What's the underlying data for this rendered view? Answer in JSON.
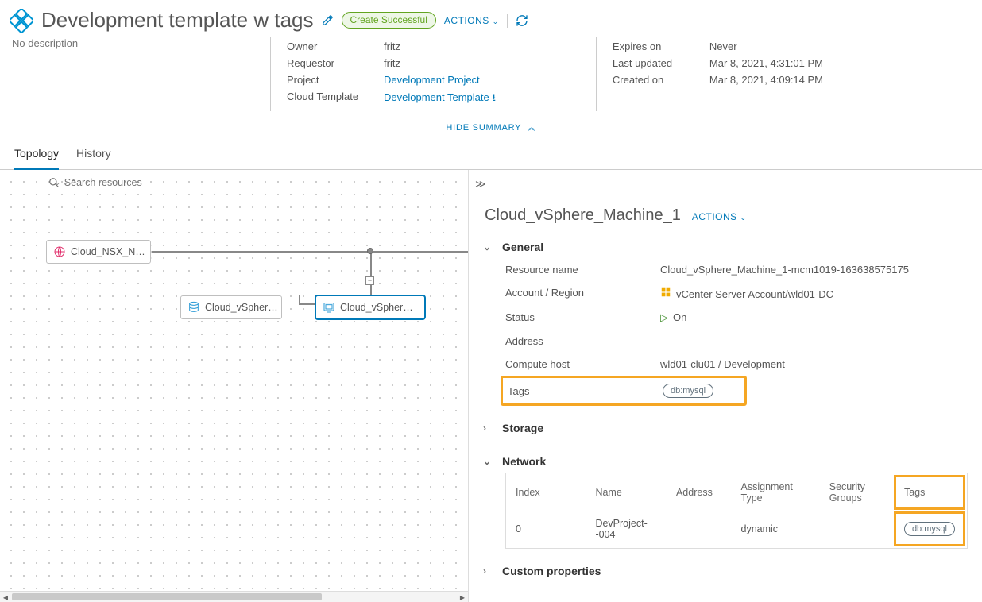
{
  "header": {
    "title": "Development template w tags",
    "no_desc": "No description",
    "status_badge": "Create Successful",
    "actions_label": "ACTIONS"
  },
  "summary": {
    "left": {
      "owner_k": "Owner",
      "owner_v": "fritz",
      "requestor_k": "Requestor",
      "requestor_v": "fritz",
      "project_k": "Project",
      "project_v": "Development Project",
      "template_k": "Cloud Template",
      "template_v": "Development Template"
    },
    "right": {
      "expires_k": "Expires on",
      "expires_v": "Never",
      "updated_k": "Last updated",
      "updated_v": "Mar 8, 2021, 4:31:01 PM",
      "created_k": "Created on",
      "created_v": "Mar 8, 2021, 4:09:14 PM"
    },
    "hide": "HIDE SUMMARY"
  },
  "tabs": {
    "topology": "Topology",
    "history": "History"
  },
  "search": {
    "placeholder": "Search resources"
  },
  "pager": {
    "value": "-"
  },
  "nodes": {
    "nsx": "Cloud_NSX_N…",
    "vsphere1": "Cloud_vSpher…",
    "vsphere2": "Cloud_vSpher…"
  },
  "detail": {
    "title": "Cloud_vSphere_Machine_1",
    "actions": "ACTIONS",
    "sections": {
      "general": "General",
      "storage": "Storage",
      "network": "Network",
      "custom": "Custom properties"
    },
    "general": {
      "name_k": "Resource name",
      "name_v": "Cloud_vSphere_Machine_1-mcm1019-163638575175",
      "acct_k": "Account / Region",
      "acct_v": "vCenter Server Account/wld01-DC",
      "status_k": "Status",
      "status_v": "On",
      "addr_k": "Address",
      "host_k": "Compute host",
      "host_v": "wld01-clu01 / Development",
      "tags_k": "Tags",
      "tag1": "db:mysql"
    },
    "network": {
      "cols": {
        "index": "Index",
        "name": "Name",
        "address": "Address",
        "atype": "Assignment Type",
        "sg": "Security Groups",
        "tags": "Tags"
      },
      "row": {
        "index": "0",
        "name": "DevProject--004",
        "address": "",
        "atype": "dynamic",
        "sg": "",
        "tag": "db:mysql"
      }
    }
  }
}
